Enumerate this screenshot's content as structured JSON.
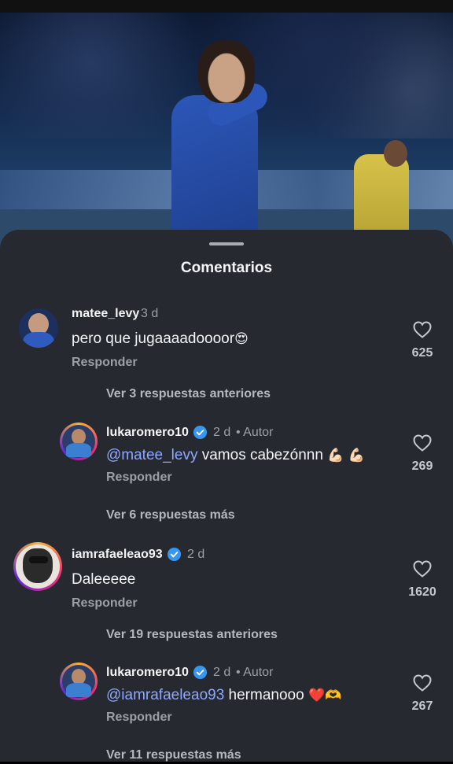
{
  "sheet": {
    "title": "Comentarios"
  },
  "icons": {
    "like": "heart-outline-icon",
    "verified": "verified-badge-icon"
  },
  "colors": {
    "mention": "#8fa7ff",
    "verified": "#3797f0",
    "sheet_bg": "#262a30"
  },
  "comments": [
    {
      "username": "matee_levy",
      "time": "3 d",
      "text": "pero que jugaaaadoooor",
      "emoji": "😍",
      "reply_label": "Responder",
      "likes": "625",
      "thread_link": "Ver 3 respuestas anteriores"
    },
    {
      "username": "lukaromero10",
      "verified": true,
      "time": "2 d",
      "author_label": "• Autor",
      "mention": "@matee_levy",
      "text": " vamos cabezónnn",
      "emoji": "💪🏻 💪🏻",
      "reply_label": "Responder",
      "likes": "269",
      "thread_link": "Ver 6 respuestas más"
    },
    {
      "username": "iamrafaeleao93",
      "verified": true,
      "time": "2 d",
      "text": "Daleeeee",
      "reply_label": "Responder",
      "likes": "1620",
      "thread_link": "Ver 19 respuestas anteriores"
    },
    {
      "username": "lukaromero10",
      "verified": true,
      "time": "2 d",
      "author_label": "• Autor",
      "mention": "@iamrafaeleao93",
      "text": " hermanooo",
      "emoji": "❤️🫶",
      "reply_label": "Responder",
      "likes": "267",
      "thread_link": "Ver 11 respuestas más"
    }
  ]
}
